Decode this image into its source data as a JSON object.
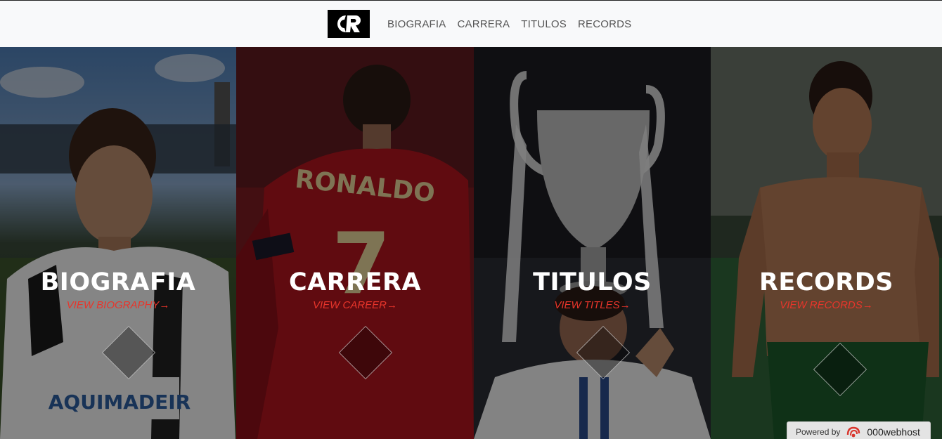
{
  "brand": {
    "logo_text": "CR",
    "logo_icon": "cr-monogram-logo"
  },
  "nav": {
    "items": [
      {
        "label": "BIOGRAFIA"
      },
      {
        "label": "CARRERA"
      },
      {
        "label": "TITULOS"
      },
      {
        "label": "RECORDS"
      }
    ]
  },
  "panels": [
    {
      "title": "BIOGRAFIA",
      "link": "VIEW BIOGRAPHY→",
      "photo": "young-player-photo"
    },
    {
      "title": "CARRERA",
      "link": "VIEW CAREER→",
      "photo": "ronaldo-jersey-back-photo",
      "jersey_name": "RONALDO",
      "jersey_number": "7"
    },
    {
      "title": "TITULOS",
      "link": "VIEW TITLES→",
      "photo": "champions-trophy-photo"
    },
    {
      "title": "RECORDS",
      "link": "VIEW RECORDS→",
      "photo": "celebration-photo"
    }
  ],
  "colors": {
    "accent": "#e8352b",
    "navbar_bg": "#f8f9fa",
    "nav_text": "#555555"
  },
  "footer_badge": {
    "prefix": "Powered by",
    "host": "000webhost"
  }
}
